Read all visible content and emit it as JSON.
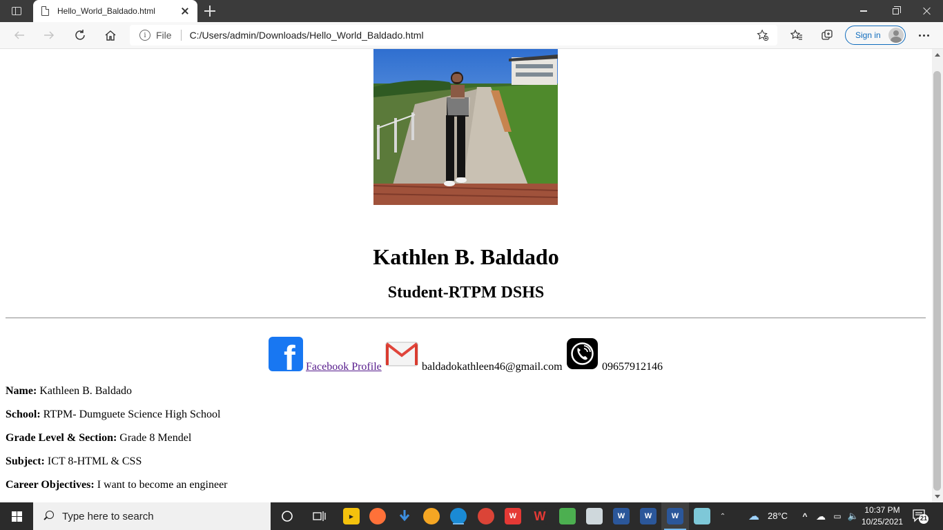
{
  "browser": {
    "tab_title": "Hello_World_Baldado.html",
    "address_scheme_label": "File",
    "address_url": "C:/Users/admin/Downloads/Hello_World_Baldado.html",
    "signin_label": "Sign in"
  },
  "page": {
    "name_heading": "Kathlen B. Baldado",
    "role_heading": "Student-RTPM DSHS",
    "contacts": {
      "facebook_link": "Facebook Profile",
      "email": "baldadokathleen46@gmail.com",
      "phone": "09657912146"
    },
    "info": [
      {
        "label": "Name:",
        "value": " Kathleen B. Baldado"
      },
      {
        "label": "School:",
        "value": " RTPM- Dumguete Science High School"
      },
      {
        "label": "Grade Level & Section:",
        "value": " Grade 8 Mendel"
      },
      {
        "label": "Subject:",
        "value": " ICT 8-HTML & CSS"
      },
      {
        "label": "Career Objectives:",
        "value": " I want to become an engineer"
      }
    ]
  },
  "taskbar": {
    "search_placeholder": "Type here to search",
    "weather": "28°C",
    "time": "10:37 PM",
    "date": "10/25/2021",
    "notification_count": "21"
  },
  "icons": {
    "facebook": "facebook-icon",
    "email": "gmail-icon",
    "phone": "phone-icon"
  },
  "colors": {
    "link_visited": "#551a8b",
    "facebook_blue": "#1877f2",
    "signin_blue": "#0f6cbd",
    "taskbar_bg": "#2b2b2b"
  }
}
